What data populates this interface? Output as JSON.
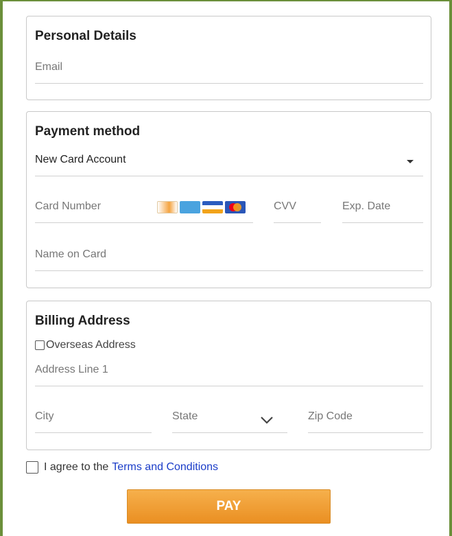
{
  "personal": {
    "title": "Personal Details",
    "email_placeholder": "Email"
  },
  "payment": {
    "title": "Payment method",
    "method_selected": "New Card Account",
    "card_number_placeholder": "Card Number",
    "cvv_placeholder": "CVV",
    "exp_placeholder": "Exp. Date",
    "name_placeholder": "Name on Card",
    "card_logos": [
      "discover-logo",
      "amex-logo",
      "visa-logo",
      "mastercard-logo"
    ]
  },
  "billing": {
    "title": "Billing Address",
    "overseas_label": "Overseas Address",
    "address1_placeholder": "Address Line 1",
    "city_placeholder": "City",
    "state_placeholder": "State",
    "zip_placeholder": "Zip Code"
  },
  "terms": {
    "prefix": "I agree to the",
    "link": "Terms and Conditions"
  },
  "pay": {
    "label": "PAY"
  },
  "colors": {
    "frame": "#6b8f3a",
    "button": "#ea8f22",
    "link": "#1a3cc8"
  }
}
